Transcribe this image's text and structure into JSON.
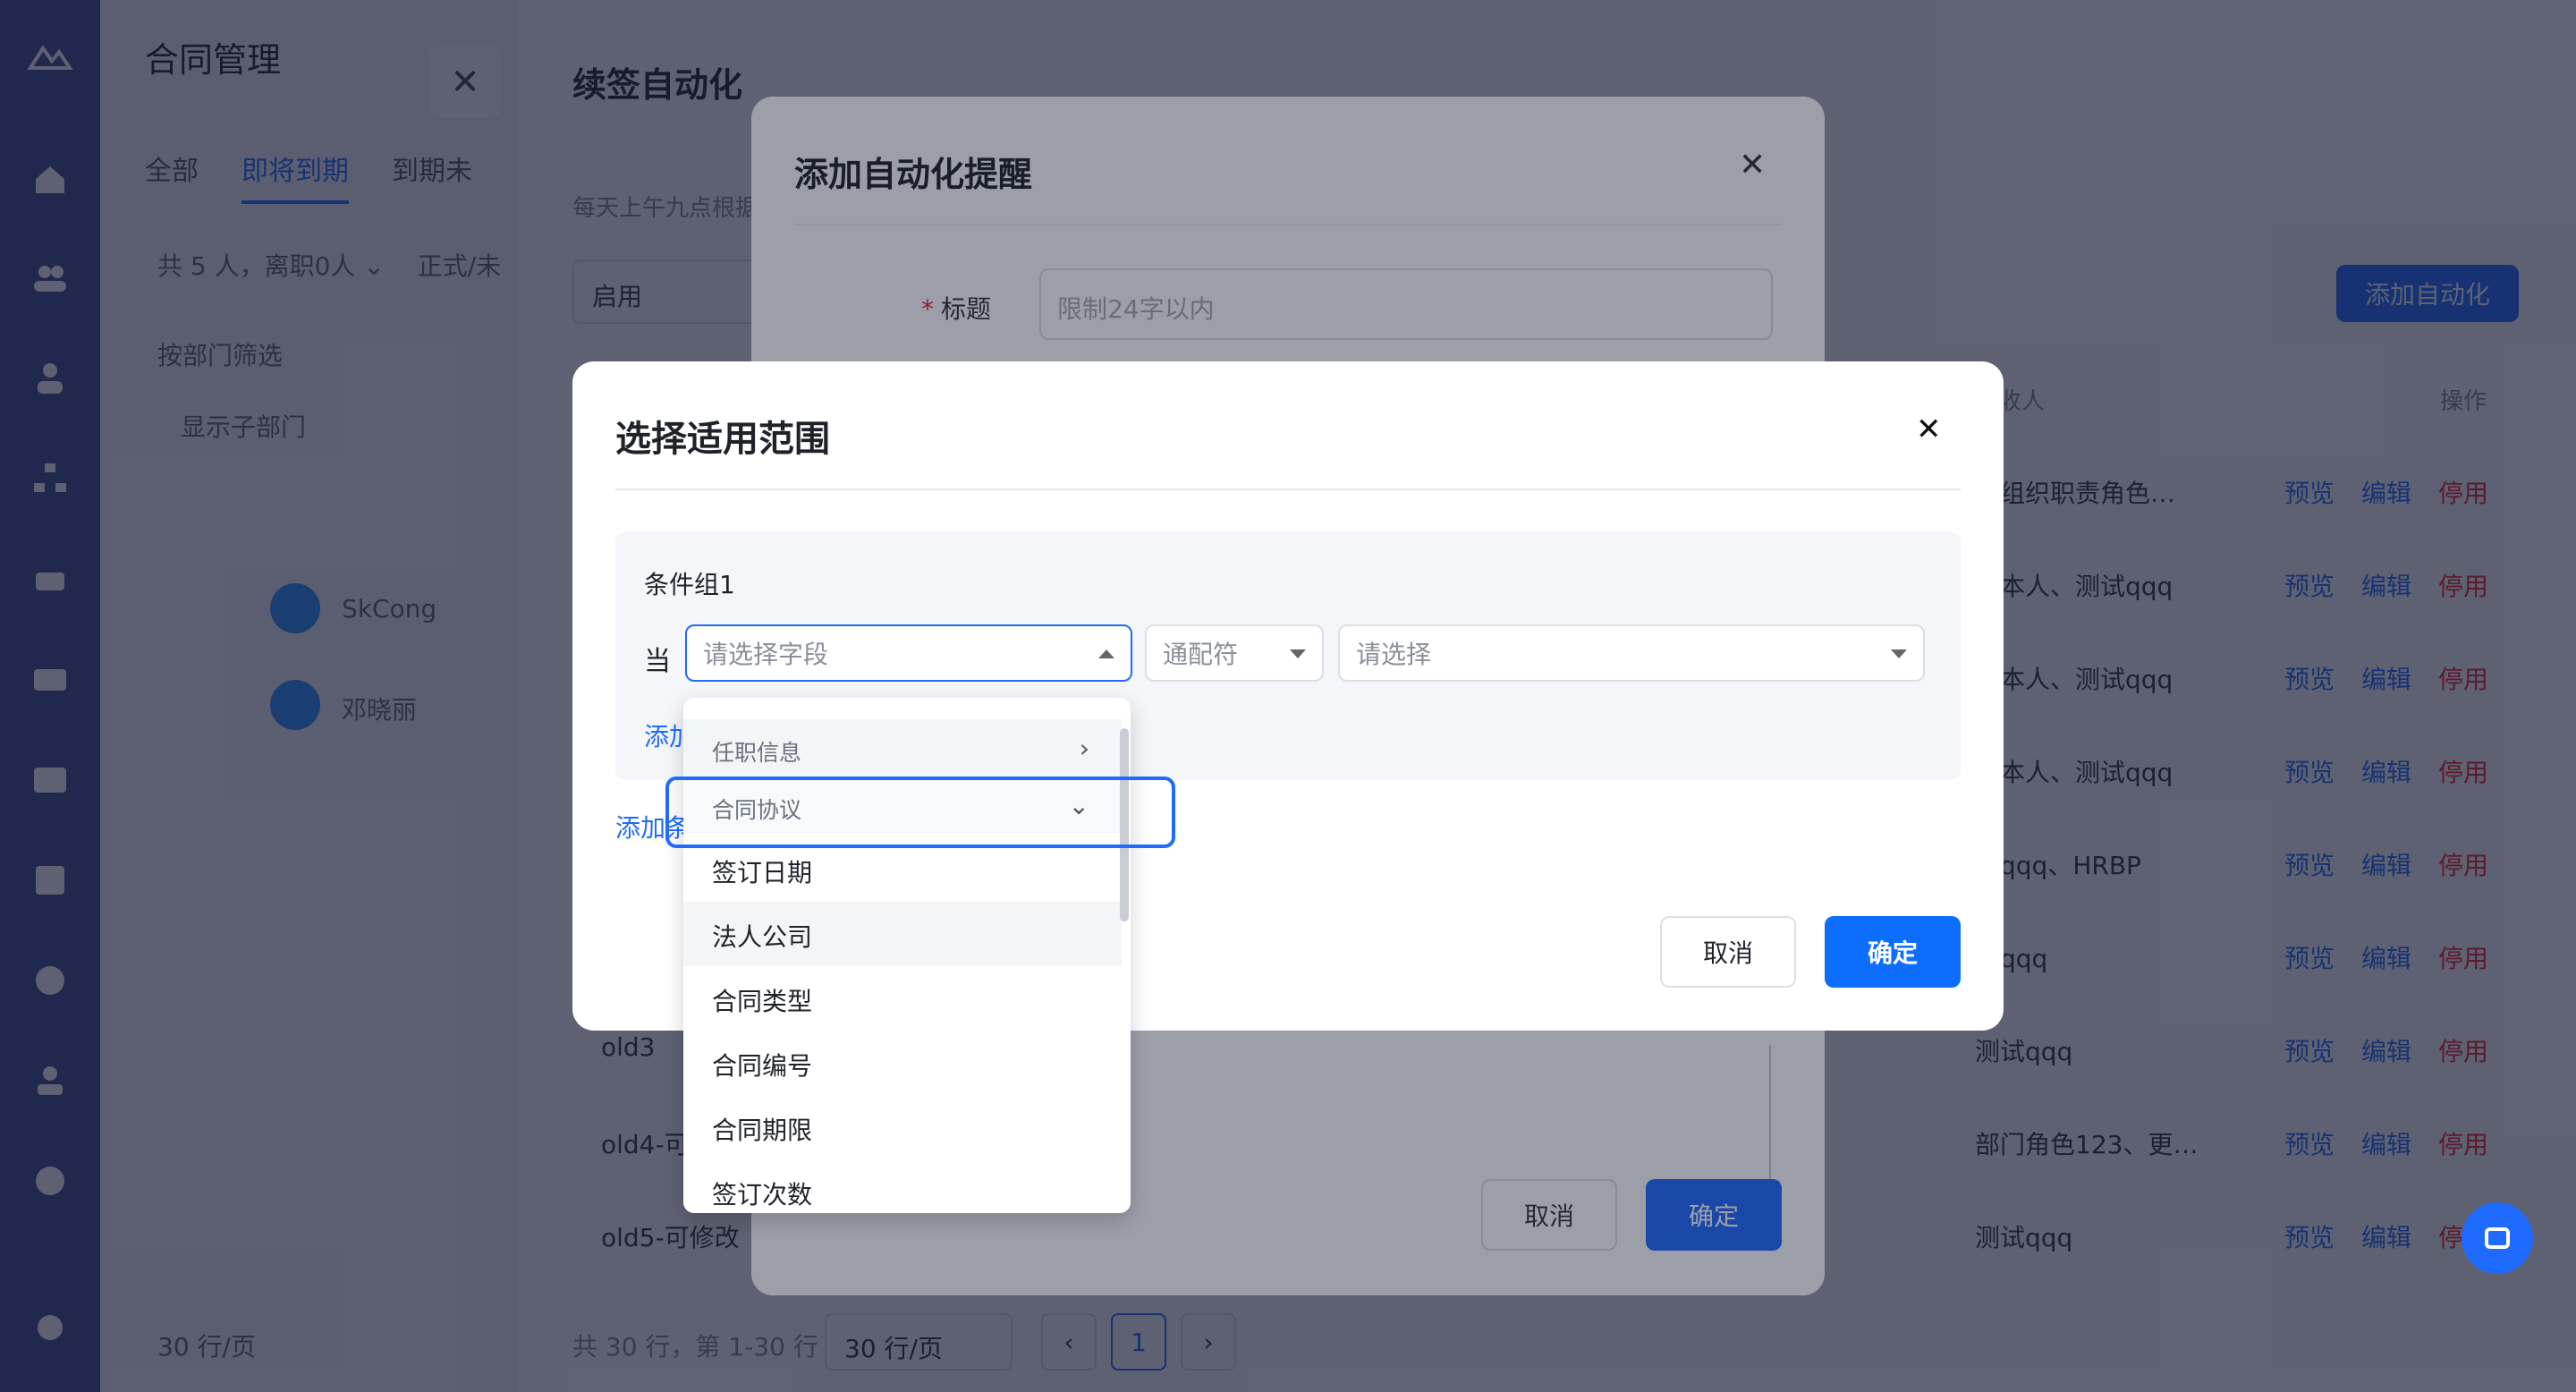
{
  "base": {
    "panel_title": "合同管理",
    "tabs": [
      "全部",
      "即将到期",
      "到期未"
    ],
    "filter_row": [
      "共 5 人，离职0人 ⌄",
      "正式/未"
    ],
    "left_rows": [
      "按部门筛选",
      "显示子部门"
    ],
    "people": [
      "SkCong",
      "邓晓丽"
    ],
    "page_title": "续签自动化",
    "hint": "每天上午九点根据",
    "status_select": "启用",
    "add_button": "添加自动化",
    "col_receiver": "接收人",
    "col_action": "操作",
    "rows": [
      {
        "name": "",
        "receiver": "建组织职责角色…"
      },
      {
        "name": "",
        "receiver": "工本人、测试qqq"
      },
      {
        "name": "",
        "receiver": "工本人、测试qqq"
      },
      {
        "name": "",
        "receiver": "工本人、测试qqq"
      },
      {
        "name": "",
        "receiver": "试qqq、HRBP"
      },
      {
        "name": "",
        "receiver": "试qqq"
      },
      {
        "name": "old3",
        "receiver": "测试qqq"
      },
      {
        "name": "old4-可",
        "receiver": "部门角色123、更…"
      },
      {
        "name": "old5-可修改",
        "receiver": "测试qqq"
      }
    ],
    "row_actions": {
      "preview": "预览",
      "edit": "编辑",
      "disable": "停用"
    },
    "pager_text": "共 30 行，第 1-30 行",
    "page_size": "30 行/页",
    "left_pager": "30 行/页",
    "current_page": "1"
  },
  "dialog_reminder": {
    "title": "添加自动化提醒",
    "title_label": "标题",
    "title_placeholder": "限制24字以内",
    "cancel": "取消",
    "confirm": "确定"
  },
  "dialog_scope": {
    "title": "选择适用范围",
    "group_title": "条件组1",
    "when_label": "当",
    "field_placeholder": "请选择字段",
    "operator_placeholder": "通配符",
    "value_placeholder": "请选择",
    "add_condition": "添加",
    "add_group": "添加条",
    "cancel": "取消",
    "confirm": "确定"
  },
  "dropdown": {
    "categories": [
      "任职信息",
      "合同协议"
    ],
    "options": [
      "签订日期",
      "法人公司",
      "合同类型",
      "合同编号",
      "合同期限",
      "签订次数"
    ]
  },
  "colors": {
    "accent": "#1f6bff",
    "danger": "#f5222d",
    "sidebar": "#3d4f8c"
  }
}
